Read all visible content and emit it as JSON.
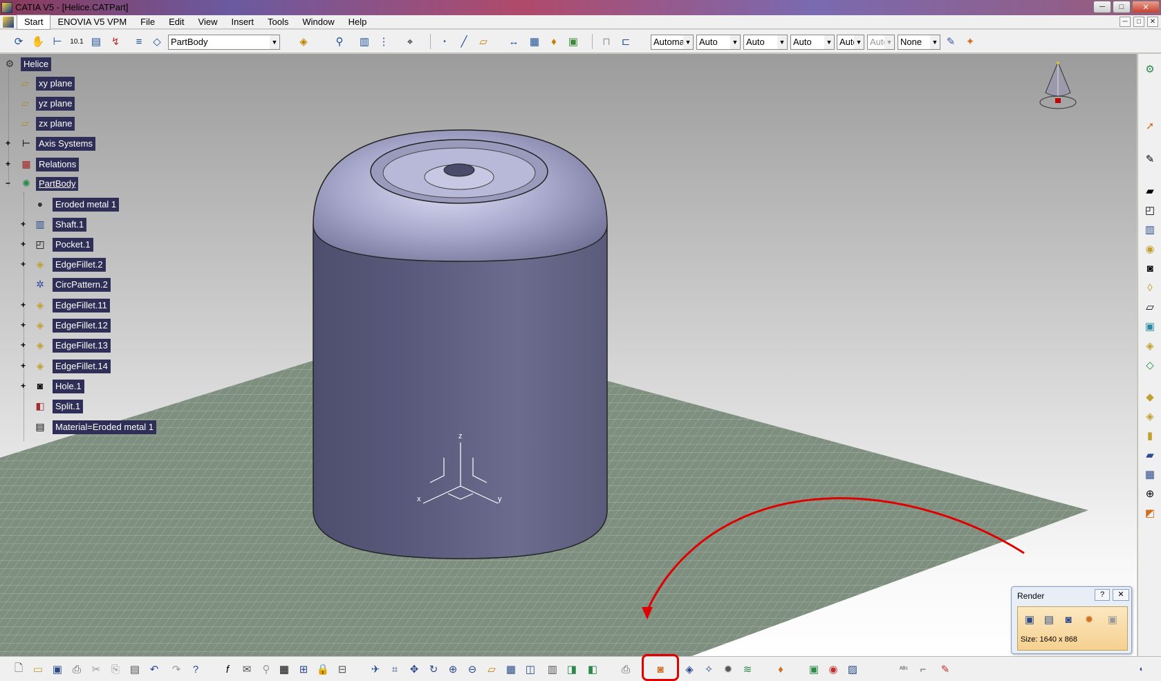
{
  "window": {
    "title": "CATIA V5 - [Helice.CATPart]",
    "minimize": "─",
    "maximize": "□",
    "close": "✕"
  },
  "menu": {
    "items": [
      "Start",
      "ENOVIA V5 VPM",
      "File",
      "Edit",
      "View",
      "Insert",
      "Tools",
      "Window",
      "Help"
    ]
  },
  "toolbar_top": {
    "body_select": "PartBody",
    "dropdowns": [
      "Automatic",
      "Auto",
      "Auto",
      "Auto",
      "Auto",
      "Auto",
      "None"
    ]
  },
  "tree": {
    "root": "Helice",
    "nodes": [
      {
        "label": "xy plane",
        "icon": "plane-icon"
      },
      {
        "label": "yz plane",
        "icon": "plane-icon"
      },
      {
        "label": "zx plane",
        "icon": "plane-icon"
      },
      {
        "label": "Axis Systems",
        "icon": "axis-system-icon"
      },
      {
        "label": "Relations",
        "icon": "relations-icon"
      },
      {
        "label": "PartBody",
        "icon": "part-body-icon"
      },
      {
        "label": "Eroded metal 1",
        "icon": "material-sphere-icon"
      },
      {
        "label": "Shaft.1",
        "icon": "shaft-icon"
      },
      {
        "label": "Pocket.1",
        "icon": "pocket-icon"
      },
      {
        "label": "EdgeFillet.2",
        "icon": "edge-fillet-icon"
      },
      {
        "label": "CircPattern.2",
        "icon": "circular-pattern-icon"
      },
      {
        "label": "EdgeFillet.11",
        "icon": "edge-fillet-icon"
      },
      {
        "label": "EdgeFillet.12",
        "icon": "edge-fillet-icon"
      },
      {
        "label": "EdgeFillet.13",
        "icon": "edge-fillet-icon"
      },
      {
        "label": "EdgeFillet.14",
        "icon": "edge-fillet-icon"
      },
      {
        "label": "Hole.1",
        "icon": "hole-icon"
      },
      {
        "label": "Split.1",
        "icon": "split-icon"
      },
      {
        "label": "Material=Eroded metal 1",
        "icon": "material-icon"
      }
    ]
  },
  "axis_triad": {
    "x": "x",
    "y": "y",
    "z": "z"
  },
  "render_panel": {
    "title": "Render",
    "help": "?",
    "close": "✕",
    "size": "Size: 1640 x 868"
  },
  "colors": {
    "tree_label_bg": "#2e2e56",
    "part_color": "#6a6a8c",
    "annotation_red": "#e00000",
    "floor_grid": "#8a9a8a"
  }
}
